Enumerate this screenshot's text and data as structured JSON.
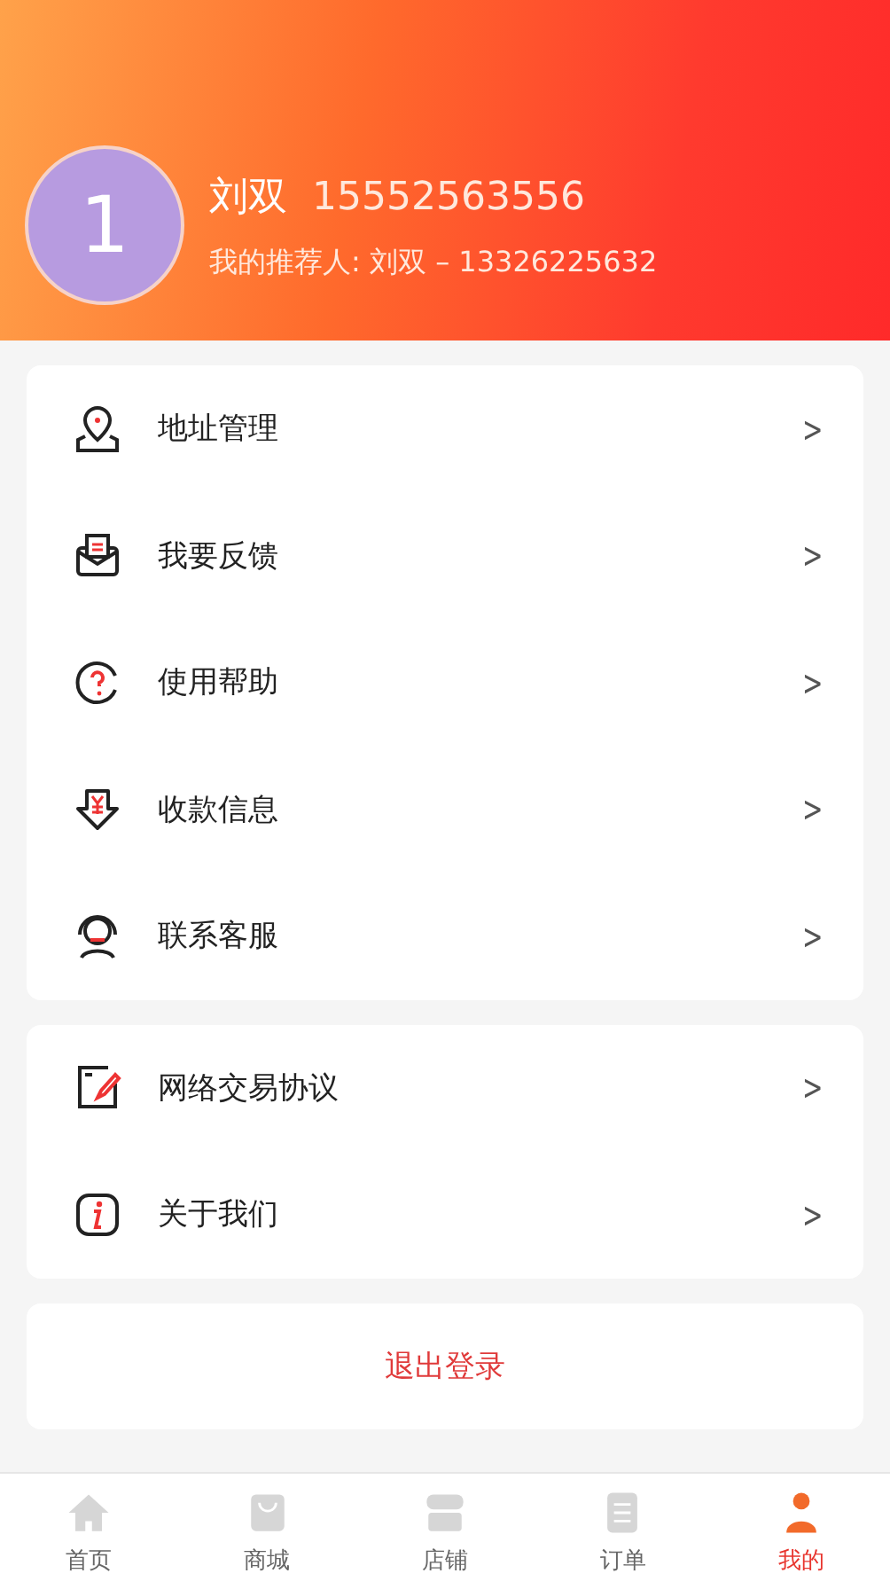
{
  "profile": {
    "avatar": "1",
    "name": "刘双",
    "phone": "15552563556",
    "referrer": "我的推荐人: 刘双 – 13326225632"
  },
  "menu_groups": [
    {
      "items": [
        {
          "label": "地址管理",
          "chevron": ">"
        },
        {
          "label": "我要反馈",
          "chevron": ">"
        },
        {
          "label": "使用帮助",
          "chevron": ">"
        },
        {
          "label": "收款信息",
          "chevron": ">"
        },
        {
          "label": "联系客服",
          "chevron": ">"
        }
      ]
    },
    {
      "items": [
        {
          "label": "网络交易协议",
          "chevron": ">"
        },
        {
          "label": "关于我们",
          "chevron": ">"
        }
      ]
    }
  ],
  "logout_button": "退出登录",
  "tab_bar": [
    {
      "label": "首页",
      "selected": false
    },
    {
      "label": "商城",
      "selected": false
    },
    {
      "label": "店铺",
      "selected": false
    },
    {
      "label": "订单",
      "selected": false
    },
    {
      "label": "我的",
      "selected": true
    }
  ]
}
